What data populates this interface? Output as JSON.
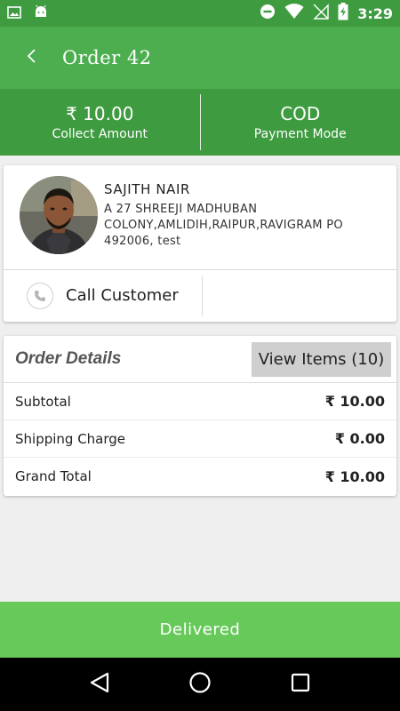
{
  "status_bar": {
    "time": "3:29"
  },
  "app_bar": {
    "title": "Order 42"
  },
  "summary": {
    "amount": "₹ 10.00",
    "amount_label": "Collect Amount",
    "payment_mode": "COD",
    "payment_mode_label": "Payment Mode"
  },
  "customer": {
    "name": "SAJITH NAIR",
    "address": "A 27 SHREEJI MADHUBAN COLONY,AMLIDIH,RAIPUR,RAVIGRAM PO 492006, test",
    "call_label": "Call Customer"
  },
  "order": {
    "title": "Order Details",
    "view_items_label": "View Items (10)",
    "rows": [
      {
        "label": "Subtotal",
        "value": "₹ 10.00"
      },
      {
        "label": "Shipping Charge",
        "value": "₹ 0.00"
      },
      {
        "label": "Grand Total",
        "value": "₹ 10.00"
      }
    ]
  },
  "action": {
    "delivered_label": "Delivered"
  },
  "colors": {
    "status_bar": "#3e9b40",
    "app_bar": "#4cae4f",
    "summary_bg": "#3e9b40",
    "delivered_button": "#67c95a",
    "view_items_bg": "#cfcfcf"
  },
  "icons": {
    "status_left": [
      "image-icon",
      "android-icon"
    ],
    "status_right": [
      "do-not-disturb-icon",
      "wifi-icon",
      "no-sim-icon",
      "battery-charging-icon"
    ],
    "back": "arrow-left-icon",
    "call": "phone-icon",
    "nav": [
      "back-triangle-icon",
      "home-circle-icon",
      "recents-square-icon"
    ]
  }
}
